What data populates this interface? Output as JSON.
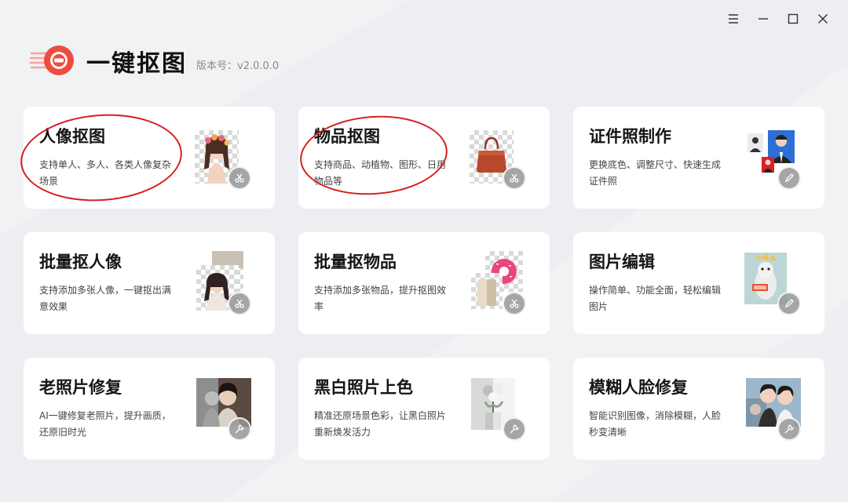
{
  "app": {
    "title": "一键抠图",
    "version_label": "版本号：v2.0.0.0"
  },
  "window_controls": [
    "menu-icon",
    "minimize-icon",
    "maximize-icon",
    "close-icon"
  ],
  "colors": {
    "brand_red": "#ef4b3f",
    "annotation_red": "#d81e1e",
    "card_bg": "#ffffff",
    "page_bg": "#f1f2f4"
  },
  "cards": [
    {
      "title": "人像抠图",
      "desc": "支持单人、多人、各类人像复杂场景",
      "thumb": "portrait-cutout",
      "badge": "scissors-icon"
    },
    {
      "title": "物品抠图",
      "desc": "支持商品、动植物、图形、日用物品等",
      "thumb": "handbag-cutout",
      "badge": "scissors-icon"
    },
    {
      "title": "证件照制作",
      "desc": "更换底色、调整尺寸、快速生成证件照",
      "thumb": "id-photos",
      "badge": "pencil-icon"
    },
    {
      "title": "批量抠人像",
      "desc": "支持添加多张人像，一键抠出满意效果",
      "thumb": "batch-portraits",
      "badge": "scissors-icon"
    },
    {
      "title": "批量抠物品",
      "desc": "支持添加多张物品，提升抠图效率",
      "thumb": "batch-objects",
      "badge": "scissors-icon"
    },
    {
      "title": "图片编辑",
      "desc": "操作简单、功能全面，轻松编辑图片",
      "thumb": "image-edit",
      "badge": "pencil-icon"
    },
    {
      "title": "老照片修复",
      "desc": "AI一键修复老照片，提升画质，还原旧时光",
      "thumb": "old-photo",
      "badge": "wrench-icon"
    },
    {
      "title": "黑白照片上色",
      "desc": "精准还原场景色彩，让黑白照片重新焕发活力",
      "thumb": "colorize",
      "badge": "wrench-icon"
    },
    {
      "title": "模糊人脸修复",
      "desc": "智能识别图像，消除模糊，人脸秒变清晰",
      "thumb": "face-restore",
      "badge": "wrench-icon"
    }
  ]
}
